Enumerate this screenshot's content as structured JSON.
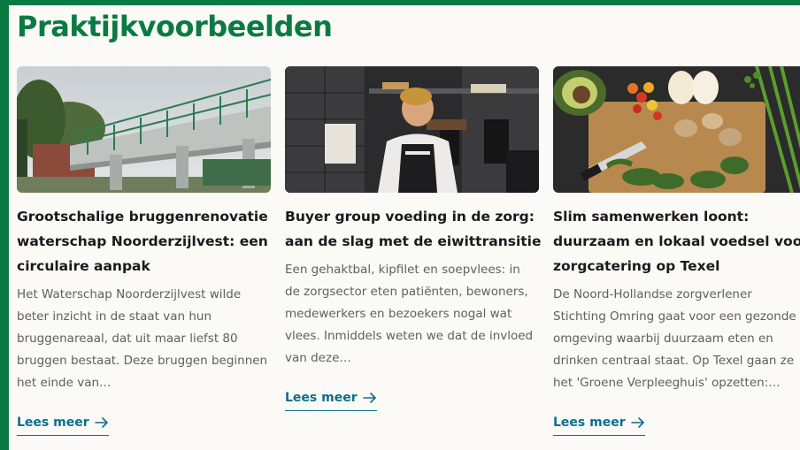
{
  "page": {
    "title": "Praktijkvoorbeelden",
    "accent_color": "#0a7a43",
    "link_color": "#0f6e8c"
  },
  "cards": [
    {
      "image_subject": "bridge-photo",
      "title_lines": [
        "Grootschalige bruggenrenovatie",
        "waterschap Noorderzijlvest: een",
        "circulaire aanpak"
      ],
      "excerpt_lines": [
        "Het Waterschap Noorderzijlvest wilde",
        "beter inzicht in de staat van hun",
        "bruggenareaal, dat uit maar liefst 80",
        "bruggen bestaat. Deze bruggen beginnen",
        "het einde van…"
      ],
      "read_more": "Lees meer"
    },
    {
      "image_subject": "chef-kitchen-photo",
      "title_lines": [
        "Buyer group voeding in de zorg:",
        "aan de slag met de eiwittransitie"
      ],
      "excerpt_lines": [
        "Een gehaktbal, kipfilet en soepvlees: in",
        "de zorgsector eten patiënten, bewoners,",
        "medewerkers en bezoekers nogal wat",
        "vlees. Inmiddels weten we dat de invloed",
        "van deze…"
      ],
      "read_more": "Lees meer"
    },
    {
      "image_subject": "vegetables-cutting-board-photo",
      "title_lines": [
        "Slim samenwerken loont:",
        "duurzaam en lokaal voedsel voor",
        "zorgcatering op Texel"
      ],
      "excerpt_lines": [
        "De Noord-Hollandse zorgverlener",
        "Stichting Omring gaat voor een gezonde",
        "omgeving waarbij duurzaam eten en",
        "drinken centraal staat. Op Texel gaan ze",
        "het 'Groene Verpleeghuis' opzetten:…"
      ],
      "read_more": "Lees meer"
    }
  ]
}
